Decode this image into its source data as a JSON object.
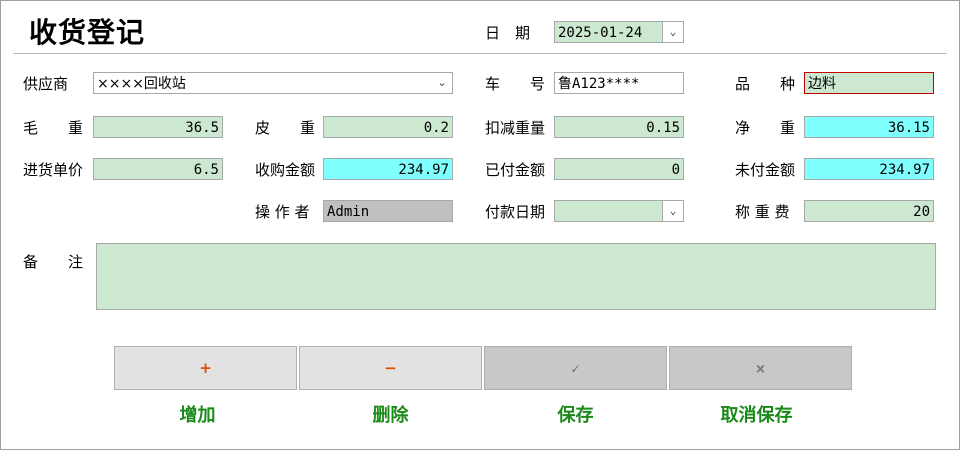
{
  "window": {
    "title": "收货登记"
  },
  "fields": {
    "date": {
      "label": "日　期",
      "value": "2025-01-24"
    },
    "supplier": {
      "label": "供应商",
      "value": "××××回收站"
    },
    "plate": {
      "label": "车　　号",
      "value": "鲁A123****"
    },
    "variety": {
      "label": "品　　种",
      "value": "边料"
    },
    "gross": {
      "label": "毛　　重",
      "value": "36.5"
    },
    "tare": {
      "label": "皮　　重",
      "value": "0.2"
    },
    "deduct": {
      "label": "扣减重量",
      "value": "0.15"
    },
    "net": {
      "label": "净　　重",
      "value": "36.15"
    },
    "price": {
      "label": "进货单价",
      "value": "6.5"
    },
    "amount": {
      "label": "收购金额",
      "value": "234.97"
    },
    "paid": {
      "label": "已付金额",
      "value": "0"
    },
    "unpaid": {
      "label": "未付金额",
      "value": "234.97"
    },
    "operator": {
      "label": "操 作 者",
      "value": "Admin"
    },
    "paydate": {
      "label": "付款日期",
      "value": ""
    },
    "weighfee": {
      "label": "称 重 费",
      "value": "20"
    },
    "remark": {
      "label": "备　　注",
      "value": ""
    }
  },
  "buttons": {
    "add": {
      "icon": "+",
      "label": "增加",
      "icon_color": "#e05000"
    },
    "delete": {
      "icon": "−",
      "label": "删除",
      "icon_color": "#e05000"
    },
    "save": {
      "icon": "✓",
      "label": "保存",
      "icon_color": "#707070"
    },
    "cancel": {
      "icon": "×",
      "label": "取消保存",
      "icon_color": "#707070"
    }
  },
  "colors": {
    "field_bg": "#cce8d0",
    "highlight_bg": "#80ffff",
    "readonly_bg": "#c0c0c0",
    "button_label": "#1a8a1a"
  }
}
